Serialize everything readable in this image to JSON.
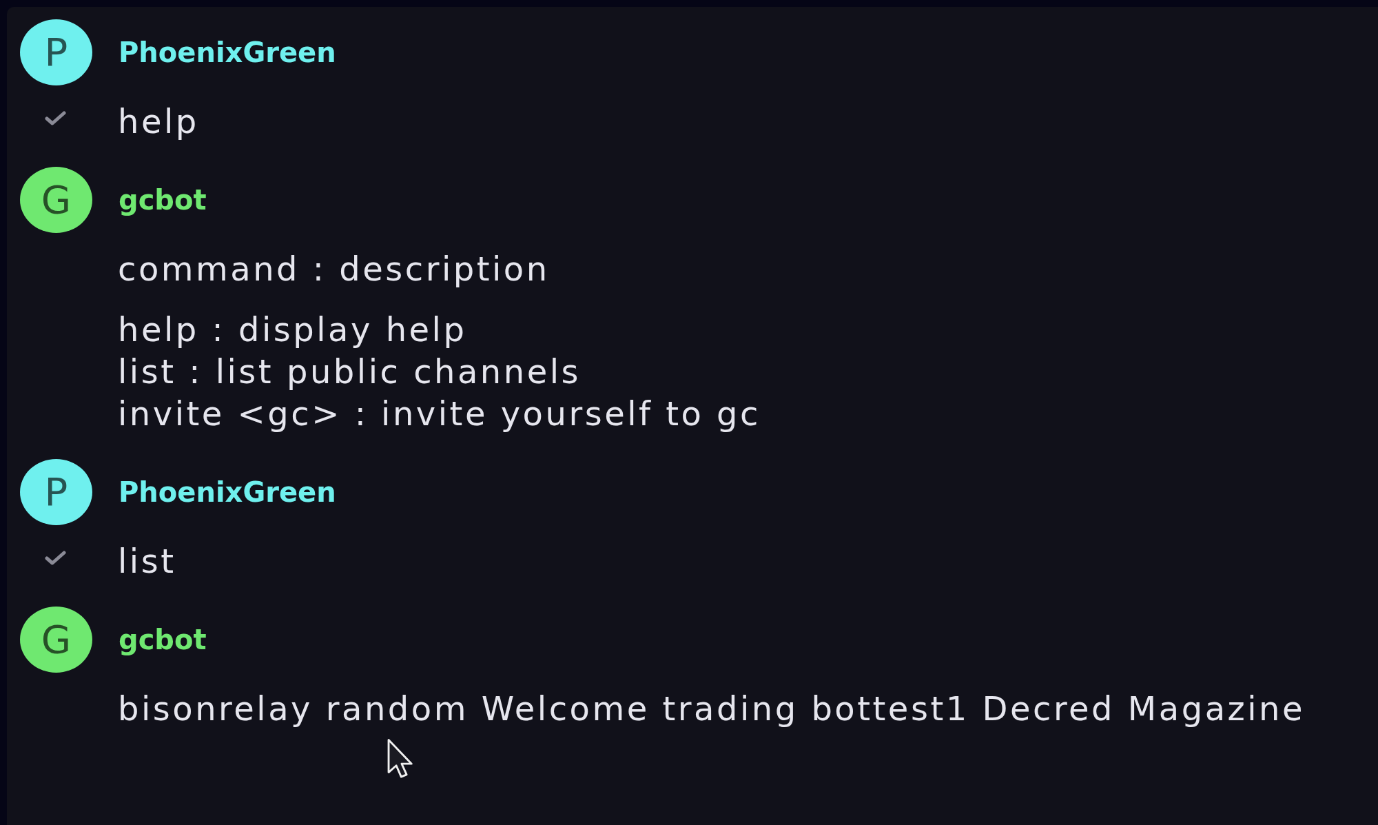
{
  "messages": [
    {
      "author": "PhoenixGreen",
      "avatar_initial": "P",
      "color": "#6ff0ee",
      "acknowledged": true,
      "body": [
        {
          "lines": [
            "help"
          ]
        }
      ]
    },
    {
      "author": "gcbot",
      "avatar_initial": "G",
      "color": "#6fe870",
      "acknowledged": false,
      "body": [
        {
          "lines": [
            "command : description"
          ]
        },
        {
          "lines": [
            "help : display help",
            "list : list public channels",
            "invite <gc> : invite yourself to gc"
          ]
        }
      ]
    },
    {
      "author": "PhoenixGreen",
      "avatar_initial": "P",
      "color": "#6ff0ee",
      "acknowledged": true,
      "body": [
        {
          "lines": [
            "list"
          ]
        }
      ]
    },
    {
      "author": "gcbot",
      "avatar_initial": "G",
      "color": "#6fe870",
      "acknowledged": false,
      "body": [
        {
          "lines": [
            "bisonrelay random Welcome trading bottest1 Decred Magazine"
          ]
        }
      ]
    }
  ]
}
